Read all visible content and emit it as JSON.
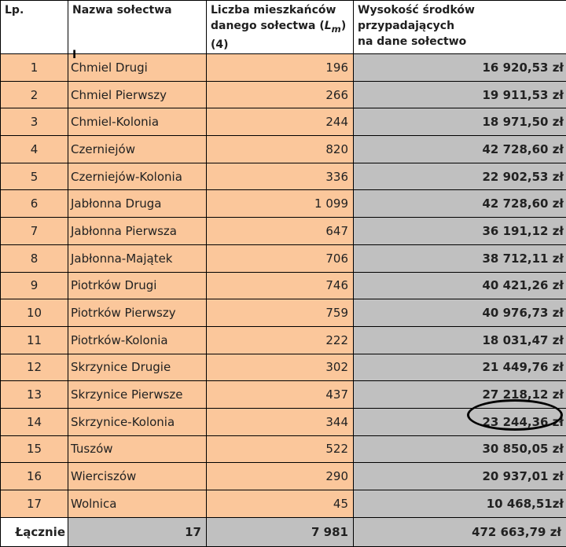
{
  "headers": {
    "lp": "Lp.",
    "name": "Nazwa sołectwa",
    "pop_line1": "Liczba mieszkańców",
    "pop_line2": "danego sołectwa (",
    "pop_lm": "L",
    "pop_lm_sub": "m",
    "pop_line2_end": ")",
    "pop_line3": "(4)",
    "amt_line1": "Wysokość środków przypadających",
    "amt_line2": "na dane sołectwo"
  },
  "rows": [
    {
      "lp": "1",
      "name": "Chmiel Drugi",
      "pop": "196",
      "amt": "16 920,53 zł"
    },
    {
      "lp": "2",
      "name": "Chmiel Pierwszy",
      "pop": "266",
      "amt": "19 911,53 zł"
    },
    {
      "lp": "3",
      "name": "Chmiel-Kolonia",
      "pop": "244",
      "amt": "18 971,50 zł"
    },
    {
      "lp": "4",
      "name": "Czerniejów",
      "pop": "820",
      "amt": "42 728,60 zł"
    },
    {
      "lp": "5",
      "name": "Czerniejów-Kolonia",
      "pop": "336",
      "amt": "22 902,53 zł"
    },
    {
      "lp": "6",
      "name": "Jabłonna Druga",
      "pop": "1 099",
      "amt": "42 728,60 zł"
    },
    {
      "lp": "7",
      "name": "Jabłonna Pierwsza",
      "pop": "647",
      "amt": "36 191,12 zł"
    },
    {
      "lp": "8",
      "name": "Jabłonna-Majątek",
      "pop": "706",
      "amt": "38 712,11 zł"
    },
    {
      "lp": "9",
      "name": "Piotrków Drugi",
      "pop": "746",
      "amt": "40 421,26 zł"
    },
    {
      "lp": "10",
      "name": "Piotrków Pierwszy",
      "pop": "759",
      "amt": "40 976,73 zł"
    },
    {
      "lp": "11",
      "name": "Piotrków-Kolonia",
      "pop": "222",
      "amt": "18 031,47 zł"
    },
    {
      "lp": "12",
      "name": "Skrzynice Drugie",
      "pop": "302",
      "amt": "21 449,76 zł"
    },
    {
      "lp": "13",
      "name": "Skrzynice Pierwsze",
      "pop": "437",
      "amt": "27 218,12 zł"
    },
    {
      "lp": "14",
      "name": "Skrzynice-Kolonia",
      "pop": "344",
      "amt": "23 244,36 zł"
    },
    {
      "lp": "15",
      "name": "Tuszów",
      "pop": "522",
      "amt": "30 850,05 zł"
    },
    {
      "lp": "16",
      "name": "Wierciszów",
      "pop": "290",
      "amt": "20 937,01 zł"
    },
    {
      "lp": "17",
      "name": "Wolnica",
      "pop": "45",
      "amt": "10 468,51zł"
    }
  ],
  "total": {
    "label": "Łącznie",
    "count": "17",
    "pop": "7 981",
    "amt": "472 663,79 zł"
  },
  "colors": {
    "row_fill": "#fbc79b",
    "amount_fill": "#c0c0c0",
    "border": "#000000"
  }
}
